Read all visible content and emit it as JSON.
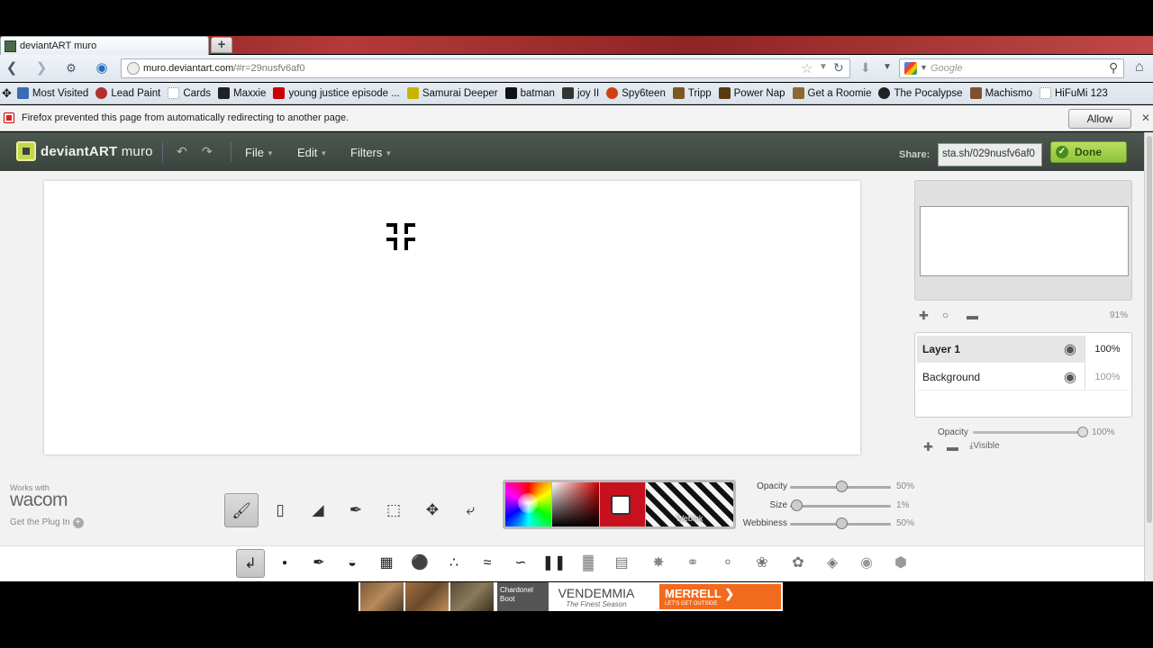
{
  "browser": {
    "tab_title": "deviantART muro",
    "new_tab_label": "+",
    "url_host": "muro.deviantart.com",
    "url_path": "/#r=29nusfv6af0",
    "search_placeholder": "Google"
  },
  "bookmarks": [
    {
      "label": "Most Visited",
      "color": "#3b6bb5"
    },
    {
      "label": "Lead Paint",
      "color": "#b03030"
    },
    {
      "label": "Cards",
      "color": "#ffffff"
    },
    {
      "label": "Maxxie",
      "color": "#222222"
    },
    {
      "label": "young justice episode ...",
      "color": "#cc0000"
    },
    {
      "label": "Samurai Deeper",
      "color": "#c8b400"
    },
    {
      "label": "batman",
      "color": "#111111"
    },
    {
      "label": "joy II",
      "color": "#333333"
    },
    {
      "label": "Spy6teen",
      "color": "#d04010"
    },
    {
      "label": "Tripp",
      "color": "#7a5a20"
    },
    {
      "label": "Power Nap",
      "color": "#5a3a10"
    },
    {
      "label": "Get a Roomie",
      "color": "#8a6a30"
    },
    {
      "label": "The Pocalypse",
      "color": "#222222"
    },
    {
      "label": "Machismo",
      "color": "#805030"
    },
    {
      "label": "HiFuMi 123",
      "color": "#ffffff"
    }
  ],
  "notification": {
    "text": "Firefox prevented this page from automatically redirecting to another page.",
    "allow_label": "Allow"
  },
  "muro": {
    "logo_bold": "deviantART",
    "logo_rest": " muro",
    "menus": [
      "File",
      "Edit",
      "Filters"
    ],
    "share_label": "Share:",
    "share_value": "sta.sh/029nusfv6af0",
    "done_label": "Done"
  },
  "navigator": {
    "zoom": "91%"
  },
  "layers": [
    {
      "name": "Layer 1",
      "opacity": "100%"
    },
    {
      "name": "Background",
      "opacity": "100%"
    }
  ],
  "layer_opacity": {
    "label": "Opacity",
    "value": "100%",
    "level": 1.0,
    "visible_label": "Visible"
  },
  "wacom": {
    "works_with": "Works with",
    "logo": "wacom",
    "plugin": "Get the Plug In"
  },
  "color_panel": {
    "webink_label": "Webink",
    "accent": "#c8101e"
  },
  "sliders": [
    {
      "label": "Opacity",
      "value": "50%",
      "level": 0.5
    },
    {
      "label": "Size",
      "value": "1%",
      "level": 0.01
    },
    {
      "label": "Webbiness",
      "value": "50%",
      "level": 0.5
    }
  ],
  "ad": {
    "chardonel": "Chardonel Boot",
    "vendemmia": "VENDEMMIA",
    "vendemmia_sub": "The Finest Season",
    "merrell": "MERRELL",
    "merrell_sub": "LET'S GET OUTSIDE"
  }
}
